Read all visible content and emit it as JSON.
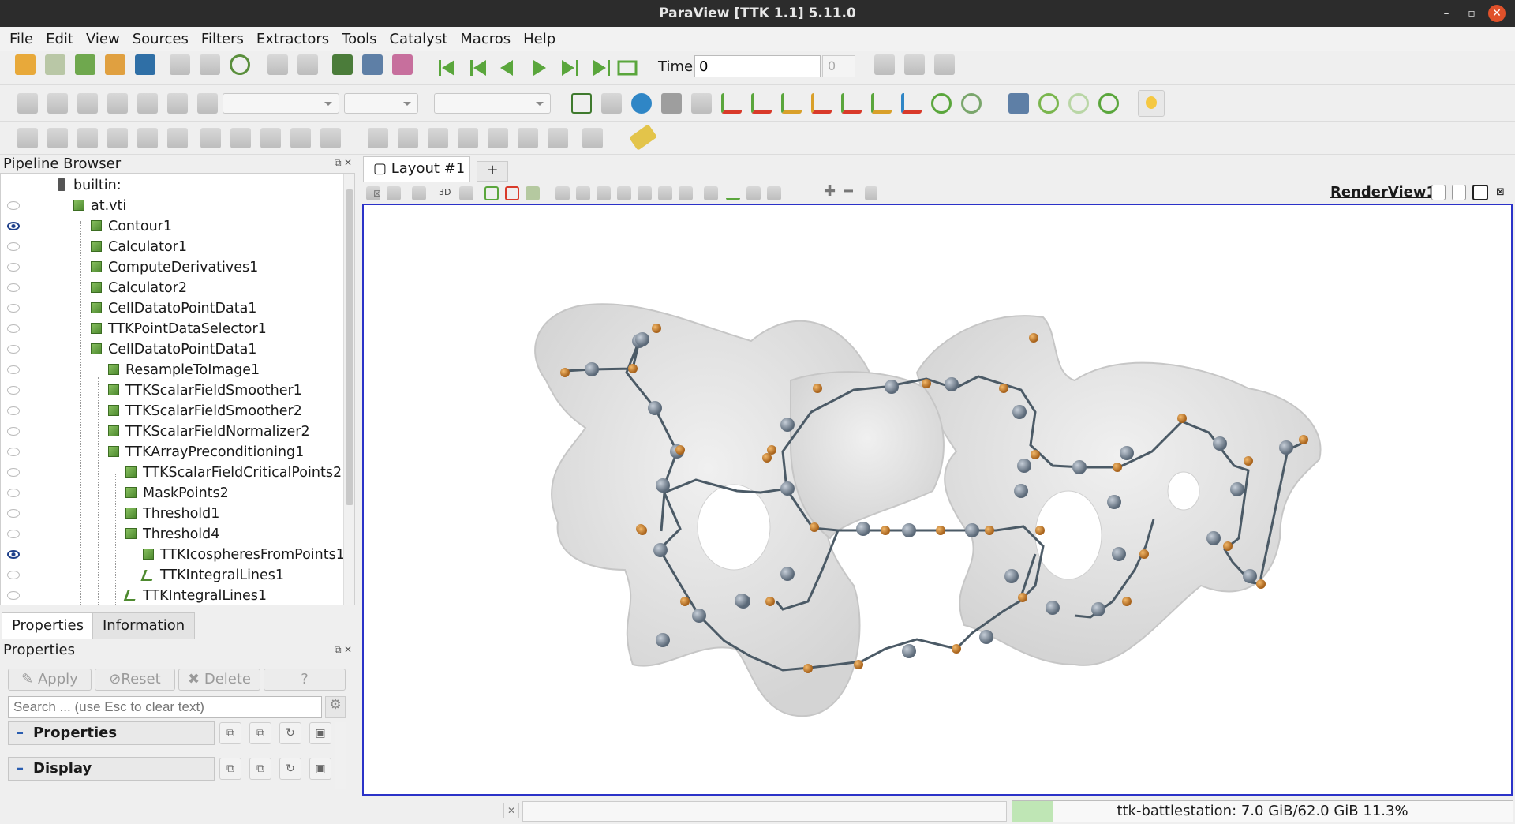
{
  "window": {
    "title": "ParaView [TTK 1.1] 5.11.0"
  },
  "menu": [
    "File",
    "Edit",
    "View",
    "Sources",
    "Filters",
    "Extractors",
    "Tools",
    "Catalyst",
    "Macros",
    "Help"
  ],
  "time": {
    "label": "Time:",
    "value": "0",
    "step": "0"
  },
  "pipeline": {
    "title": "Pipeline Browser",
    "items": [
      {
        "name": "builtin:",
        "visible": null
      },
      {
        "name": "at.vti",
        "visible": false
      },
      {
        "name": "Contour1",
        "visible": true
      },
      {
        "name": "Calculator1",
        "visible": false
      },
      {
        "name": "ComputeDerivatives1",
        "visible": false
      },
      {
        "name": "Calculator2",
        "visible": false
      },
      {
        "name": "CellDatatoPointData1",
        "visible": false
      },
      {
        "name": "TTKPointDataSelector1",
        "visible": false
      },
      {
        "name": "CellDatatoPointData1",
        "visible": false
      },
      {
        "name": "ResampleToImage1",
        "visible": false
      },
      {
        "name": "TTKScalarFieldSmoother1",
        "visible": false
      },
      {
        "name": "TTKScalarFieldSmoother2",
        "visible": false
      },
      {
        "name": "TTKScalarFieldNormalizer2",
        "visible": false
      },
      {
        "name": "TTKArrayPreconditioning1",
        "visible": false
      },
      {
        "name": "TTKScalarFieldCriticalPoints2",
        "visible": false
      },
      {
        "name": "MaskPoints2",
        "visible": false
      },
      {
        "name": "Threshold1",
        "visible": false
      },
      {
        "name": "Threshold4",
        "visible": false
      },
      {
        "name": "TTKIcospheresFromPoints1",
        "visible": true
      },
      {
        "name": "TTKIntegralLines1",
        "visible": false
      },
      {
        "name": "TTKIntegralLines1",
        "visible": false
      }
    ]
  },
  "tabs": {
    "properties": "Properties",
    "information": "Information"
  },
  "properties": {
    "title": "Properties",
    "apply": "Apply",
    "reset": "Reset",
    "delete": "Delete",
    "help": "?",
    "search_placeholder": "Search ... (use Esc to clear text)",
    "sections": [
      "Properties",
      "Display"
    ]
  },
  "layout": {
    "tab": "Layout #1",
    "add": "+",
    "render_view": "RenderView1"
  },
  "status": {
    "memory": "ttk-battlestation: 7.0 GiB/62.0 GiB 11.3%",
    "memory_fraction": 0.113
  }
}
